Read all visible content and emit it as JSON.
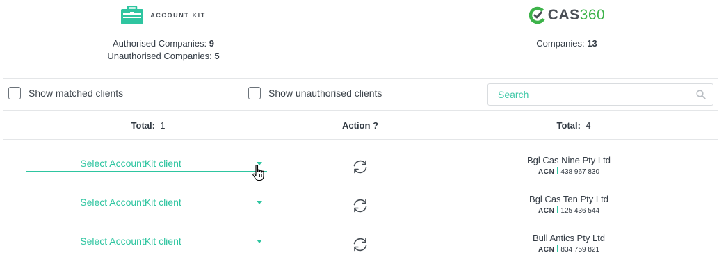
{
  "accountkit": {
    "logo_text": "ACCOUNT KIT",
    "authorised_label": "Authorised Companies:",
    "authorised_count": "9",
    "unauthorised_label": "Unauthorised Companies:",
    "unauthorised_count": "5"
  },
  "cas360": {
    "logo_text": "CAS",
    "logo_num": "360",
    "companies_label": "Companies:",
    "companies_count": "13"
  },
  "filters": {
    "show_matched_label": "Show matched clients",
    "show_matched_checked": false,
    "show_unauthorised_label": "Show unauthorised clients",
    "show_unauthorised_checked": false,
    "search_placeholder": "Search",
    "search_value": ""
  },
  "table": {
    "left_total_label": "Total:",
    "left_total_value": "1",
    "action_label": "Action ?",
    "right_total_label": "Total:",
    "right_total_value": "4"
  },
  "rows": [
    {
      "select_label": "Select AccountKit client",
      "client_name": "Bgl Cas Nine Pty Ltd",
      "acn_label": "ACN",
      "acn": "438 967 830"
    },
    {
      "select_label": "Select AccountKit client",
      "client_name": "Bgl Cas Ten Pty Ltd",
      "acn_label": "ACN",
      "acn": "125 436 544"
    },
    {
      "select_label": "Select AccountKit client",
      "client_name": "Bull Antics Pty Ltd",
      "acn_label": "ACN",
      "acn": "834 759 821"
    }
  ],
  "colors": {
    "accent": "#2ec5a0",
    "cas_green": "#3db34a",
    "text": "#333b44",
    "divider": "#e4e6e8"
  },
  "icons": [
    "briefcase-icon",
    "cas360-logo-icon",
    "search-icon",
    "caret-down-icon",
    "sync-icon",
    "hand-cursor-icon"
  ]
}
